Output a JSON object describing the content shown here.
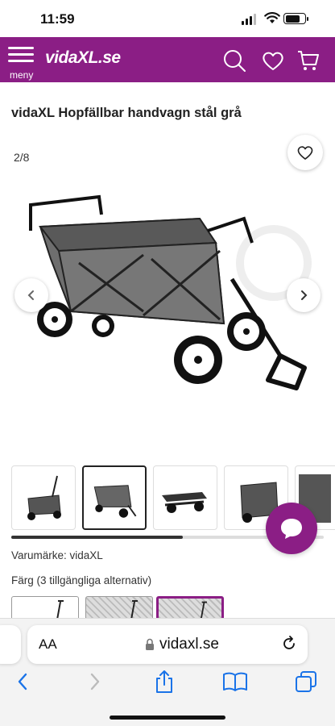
{
  "status": {
    "time": "11:59"
  },
  "header": {
    "menu_label": "meny",
    "logo": "vidaXL.se",
    "brand_color": "#8b1e85"
  },
  "product": {
    "title": "vidaXL Hopfällbar handvagn stål grå",
    "image_counter": "2/8",
    "brand_line": "Varumärke: vidaXL",
    "color_line": "Färg (3 tillgängliga alternativ)"
  },
  "thumbnails": [
    {
      "name": "thumb-1",
      "active": false
    },
    {
      "name": "thumb-2",
      "active": true
    },
    {
      "name": "thumb-3",
      "active": false
    },
    {
      "name": "thumb-4",
      "active": false
    },
    {
      "name": "thumb-5",
      "active": false
    }
  ],
  "thumb_scroll_fraction": 0.55,
  "browser": {
    "text_size_label": "AA",
    "url": "vidaxl.se"
  },
  "icons": [
    "search-icon",
    "heart-icon",
    "cart-icon",
    "chevron-left-icon",
    "chevron-right-icon",
    "chat-icon",
    "lock-icon",
    "reload-icon",
    "back-icon",
    "forward-icon",
    "share-icon",
    "bookmarks-icon",
    "tabs-icon"
  ]
}
